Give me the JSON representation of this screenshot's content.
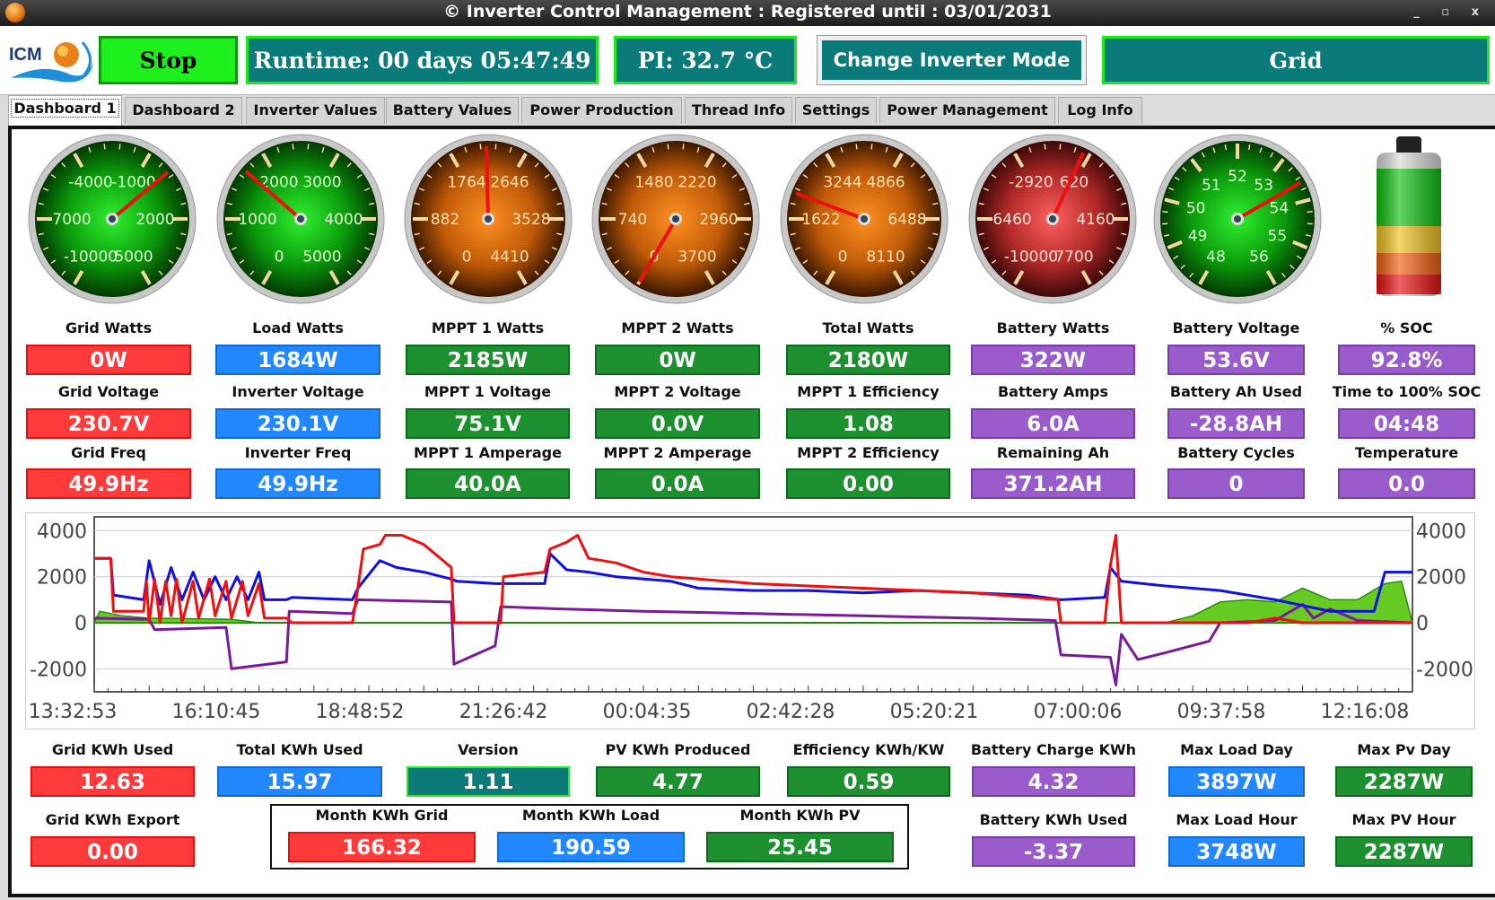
{
  "window": {
    "title": "© Inverter Control Management : Registered until : 03/01/2031",
    "controls": "_ ▫ x"
  },
  "toolbar": {
    "logo": "ICM",
    "stop": "Stop",
    "runtime": "Runtime: 00 days 05:47:49",
    "pi": "PI: 32.7 °C",
    "change_mode": "Change Inverter Mode",
    "mode": "Grid"
  },
  "tabs": [
    "Dashboard 1",
    "Dashboard 2",
    "Inverter Values",
    "Battery Values",
    "Power Production",
    "Thread Info",
    "Settings",
    "Power Management",
    "Log Info"
  ],
  "active_tab": 0,
  "gauges": [
    {
      "name": "grid-watts",
      "theme": "green",
      "min": -10000,
      "max": 5000,
      "value": 0,
      "labels": [
        "-10000",
        "-7000",
        "-4000",
        "-1000",
        "2000",
        "5000"
      ]
    },
    {
      "name": "load-watts",
      "theme": "green",
      "min": 0,
      "max": 5000,
      "value": 1684,
      "labels": [
        "0",
        "1000",
        "2000",
        "3000",
        "4000",
        "5000"
      ]
    },
    {
      "name": "mppt1-watts",
      "theme": "orange",
      "min": 0,
      "max": 4410,
      "value": 2185,
      "labels": [
        "0",
        "882",
        "1764",
        "2646",
        "3528",
        "4410"
      ]
    },
    {
      "name": "mppt2-watts",
      "theme": "orange",
      "min": 0,
      "max": 3700,
      "value": 0,
      "labels": [
        "0",
        "740",
        "1480",
        "2220",
        "2960",
        "3700"
      ]
    },
    {
      "name": "total-watts",
      "theme": "orange",
      "min": 0,
      "max": 8110,
      "value": 2180,
      "labels": [
        "0",
        "1622",
        "3244",
        "4866",
        "6488",
        "8110"
      ]
    },
    {
      "name": "battery-watts",
      "theme": "red",
      "min": -10000,
      "max": 7700,
      "value": 322,
      "labels": [
        "-10000",
        "-6460",
        "-2920",
        "620",
        "4160",
        "7700"
      ]
    },
    {
      "name": "battery-voltage",
      "theme": "green",
      "min": 48,
      "max": 56,
      "value": 53.6,
      "labels": [
        "48",
        "49",
        "50",
        "51",
        "52",
        "53",
        "54",
        "55",
        "56"
      ]
    }
  ],
  "tiles": [
    [
      {
        "label": "Grid Watts",
        "value": "0W",
        "color": "red"
      },
      {
        "label": "Load Watts",
        "value": "1684W",
        "color": "blue"
      },
      {
        "label": "MPPT 1 Watts",
        "value": "2185W",
        "color": "green"
      },
      {
        "label": "MPPT 2 Watts",
        "value": "0W",
        "color": "green"
      },
      {
        "label": "Total Watts",
        "value": "2180W",
        "color": "green"
      },
      {
        "label": "Battery Watts",
        "value": "322W",
        "color": "purple"
      },
      {
        "label": "Battery Voltage",
        "value": "53.6V",
        "color": "purple"
      },
      {
        "label": "% SOC",
        "value": "92.8%",
        "color": "purple"
      }
    ],
    [
      {
        "label": "Grid Voltage",
        "value": "230.7V",
        "color": "red"
      },
      {
        "label": "Inverter Voltage",
        "value": "230.1V",
        "color": "blue"
      },
      {
        "label": "MPPT 1 Voltage",
        "value": "75.1V",
        "color": "green"
      },
      {
        "label": "MPPT 2 Voltage",
        "value": "0.0V",
        "color": "green"
      },
      {
        "label": "MPPT 1 Efficiency",
        "value": "1.08",
        "color": "green"
      },
      {
        "label": "Battery Amps",
        "value": "6.0A",
        "color": "purple"
      },
      {
        "label": "Battery Ah Used",
        "value": "-28.8AH",
        "color": "purple"
      },
      {
        "label": "Time to 100% SOC",
        "value": "04:48",
        "color": "purple"
      }
    ],
    [
      {
        "label": "Grid Freq",
        "value": "49.9Hz",
        "color": "red"
      },
      {
        "label": "Inverter Freq",
        "value": "49.9Hz",
        "color": "blue"
      },
      {
        "label": "MPPT 1 Amperage",
        "value": "40.0A",
        "color": "green"
      },
      {
        "label": "MPPT 2 Amperage",
        "value": "0.0A",
        "color": "green"
      },
      {
        "label": "MPPT 2 Efficiency",
        "value": "0.00",
        "color": "green"
      },
      {
        "label": "Remaining Ah",
        "value": "371.2AH",
        "color": "purple"
      },
      {
        "label": "Battery Cycles",
        "value": "0",
        "color": "purple"
      },
      {
        "label": "Temperature",
        "value": "0.0",
        "color": "purple"
      }
    ]
  ],
  "totals": [
    {
      "label": "Grid KWh Used",
      "value": "12.63",
      "color": "red"
    },
    {
      "label": "Total KWh Used",
      "value": "15.97",
      "color": "blue"
    },
    {
      "label": "Version",
      "value": "1.11",
      "color": "teal"
    },
    {
      "label": "PV KWh Produced",
      "value": "4.77",
      "color": "green"
    },
    {
      "label": "Efficiency KWh/KW",
      "value": "0.59",
      "color": "green"
    },
    {
      "label": "Battery Charge KWh",
      "value": "4.32",
      "color": "purple"
    },
    {
      "label": "Max Load Day",
      "value": "3897W",
      "color": "blue"
    },
    {
      "label": "Max Pv Day",
      "value": "2287W",
      "color": "green"
    }
  ],
  "totals2": [
    {
      "label": "Grid KWh Export",
      "value": "0.00",
      "color": "red",
      "col": 0
    },
    {
      "label": "Battery KWh Used",
      "value": "-3.37",
      "color": "purple",
      "col": 5
    },
    {
      "label": "Max Load Hour",
      "value": "3748W",
      "color": "blue",
      "col": 6
    },
    {
      "label": "Max PV Hour",
      "value": "2287W",
      "color": "green",
      "col": 7
    }
  ],
  "month": [
    {
      "label": "Month KWh Grid",
      "value": "166.32",
      "color": "red"
    },
    {
      "label": "Month KWh Load",
      "value": "190.59",
      "color": "blue"
    },
    {
      "label": "Month KWh PV",
      "value": "25.45",
      "color": "green"
    }
  ],
  "chart_data": {
    "type": "line",
    "title": "",
    "xlabel": "",
    "ylabel": "",
    "ylim": [
      -3000,
      4600
    ],
    "xlim_hours": [
      0,
      24
    ],
    "yticks": [
      "4000",
      "2000",
      "0",
      "-2000"
    ],
    "ytick_values": [
      4000,
      2000,
      0,
      -2000
    ],
    "xtick_labels": [
      "13:32:53",
      "16:10:45",
      "18:48:52",
      "21:26:42",
      "00:04:35",
      "02:42:28",
      "05:20:21",
      "07:00:06",
      "09:37:58",
      "12:16:08"
    ],
    "grid": true,
    "series": [
      {
        "name": "pv",
        "color": "#66cc22",
        "fill": true,
        "points": [
          [
            0,
            0
          ],
          [
            0.1,
            500
          ],
          [
            0.5,
            300
          ],
          [
            1,
            200
          ],
          [
            2.5,
            150
          ],
          [
            3,
            0
          ],
          [
            19.5,
            0
          ],
          [
            20,
            300
          ],
          [
            20.5,
            900
          ],
          [
            21,
            1000
          ],
          [
            21.5,
            900
          ],
          [
            22,
            1500
          ],
          [
            22.5,
            1000
          ],
          [
            23,
            1000
          ],
          [
            23.5,
            1700
          ],
          [
            23.8,
            1800
          ],
          [
            24,
            0
          ]
        ]
      },
      {
        "name": "battery",
        "color": "#7a1a9a",
        "points": [
          [
            0,
            200
          ],
          [
            1,
            150
          ],
          [
            1.1,
            -300
          ],
          [
            2.4,
            -200
          ],
          [
            2.5,
            -2000
          ],
          [
            3.5,
            -1700
          ],
          [
            3.55,
            500
          ],
          [
            4.7,
            400
          ],
          [
            4.8,
            1000
          ],
          [
            6.5,
            900
          ],
          [
            6.55,
            -1800
          ],
          [
            7.3,
            -1000
          ],
          [
            7.4,
            700
          ],
          [
            8.5,
            600
          ],
          [
            10,
            500
          ],
          [
            12,
            400
          ],
          [
            14,
            300
          ],
          [
            16,
            200
          ],
          [
            17.5,
            100
          ],
          [
            17.6,
            -1400
          ],
          [
            18.5,
            -1500
          ],
          [
            18.6,
            -2700
          ],
          [
            18.7,
            -500
          ],
          [
            19,
            -1600
          ],
          [
            19.5,
            -1300
          ],
          [
            20.3,
            -800
          ],
          [
            20.5,
            0
          ],
          [
            21.5,
            100
          ],
          [
            22,
            800
          ],
          [
            22.2,
            200
          ],
          [
            22.5,
            600
          ],
          [
            23,
            100
          ],
          [
            24,
            0
          ]
        ]
      },
      {
        "name": "load",
        "color": "#1010e0",
        "points": [
          [
            0,
            2800
          ],
          [
            0.3,
            2800
          ],
          [
            0.35,
            1200
          ],
          [
            0.9,
            1000
          ],
          [
            1,
            2700
          ],
          [
            1.2,
            800
          ],
          [
            1.4,
            2400
          ],
          [
            1.6,
            1000
          ],
          [
            1.8,
            2200
          ],
          [
            2,
            1000
          ],
          [
            2.2,
            2000
          ],
          [
            2.4,
            1000
          ],
          [
            2.6,
            2000
          ],
          [
            2.8,
            1000
          ],
          [
            3,
            2200
          ],
          [
            3.1,
            1000
          ],
          [
            3.5,
            1000
          ],
          [
            3.6,
            1100
          ],
          [
            4.7,
            1000
          ],
          [
            4.8,
            1500
          ],
          [
            5.2,
            2700
          ],
          [
            5.5,
            2400
          ],
          [
            6,
            2200
          ],
          [
            6.5,
            1900
          ],
          [
            6.6,
            1800
          ],
          [
            7.3,
            1700
          ],
          [
            8.2,
            1700
          ],
          [
            8.3,
            3000
          ],
          [
            8.6,
            2300
          ],
          [
            9,
            2200
          ],
          [
            9.5,
            2000
          ],
          [
            10,
            1900
          ],
          [
            10.5,
            1800
          ],
          [
            11,
            1500
          ],
          [
            12,
            1400
          ],
          [
            13,
            1400
          ],
          [
            14,
            1300
          ],
          [
            15,
            1400
          ],
          [
            16,
            1300
          ],
          [
            17,
            1200
          ],
          [
            17.6,
            1000
          ],
          [
            18.4,
            1100
          ],
          [
            18.5,
            2400
          ],
          [
            18.7,
            1800
          ],
          [
            19.5,
            1600
          ],
          [
            20.5,
            1400
          ],
          [
            21.5,
            1000
          ],
          [
            22.5,
            500
          ],
          [
            23.3,
            500
          ],
          [
            23.5,
            2200
          ],
          [
            24,
            2200
          ]
        ]
      },
      {
        "name": "grid",
        "color": "#ee1010",
        "points": [
          [
            0,
            2800
          ],
          [
            0.3,
            2800
          ],
          [
            0.35,
            500
          ],
          [
            0.9,
            500
          ],
          [
            0.95,
            1800
          ],
          [
            1,
            0
          ],
          [
            1.1,
            1900
          ],
          [
            1.2,
            0
          ],
          [
            1.3,
            1800
          ],
          [
            1.4,
            300
          ],
          [
            1.5,
            1900
          ],
          [
            1.6,
            0
          ],
          [
            1.8,
            1800
          ],
          [
            1.9,
            200
          ],
          [
            2.1,
            1900
          ],
          [
            2.2,
            300
          ],
          [
            2.4,
            1800
          ],
          [
            2.5,
            200
          ],
          [
            2.7,
            1800
          ],
          [
            2.8,
            300
          ],
          [
            3,
            1700
          ],
          [
            3.1,
            200
          ],
          [
            3.5,
            200
          ],
          [
            3.6,
            0
          ],
          [
            4.7,
            0
          ],
          [
            4.8,
            1500
          ],
          [
            4.9,
            3200
          ],
          [
            5.2,
            3400
          ],
          [
            5.3,
            3800
          ],
          [
            5.6,
            3800
          ],
          [
            6,
            3400
          ],
          [
            6.5,
            2400
          ],
          [
            6.55,
            0
          ],
          [
            7.4,
            0
          ],
          [
            7.45,
            2000
          ],
          [
            8.2,
            2200
          ],
          [
            8.3,
            3200
          ],
          [
            8.6,
            3500
          ],
          [
            8.8,
            3800
          ],
          [
            9,
            2800
          ],
          [
            9.5,
            2600
          ],
          [
            10,
            2200
          ],
          [
            10.5,
            2000
          ],
          [
            11,
            1900
          ],
          [
            12,
            1700
          ],
          [
            13,
            1600
          ],
          [
            14,
            1500
          ],
          [
            15,
            1400
          ],
          [
            16,
            1300
          ],
          [
            17,
            1100
          ],
          [
            17.55,
            1000
          ],
          [
            17.6,
            0
          ],
          [
            18.4,
            0
          ],
          [
            18.5,
            2500
          ],
          [
            18.6,
            3800
          ],
          [
            18.7,
            0
          ],
          [
            19,
            0
          ],
          [
            21,
            0
          ],
          [
            21.5,
            200
          ],
          [
            22,
            0
          ],
          [
            24,
            0
          ]
        ]
      }
    ]
  }
}
